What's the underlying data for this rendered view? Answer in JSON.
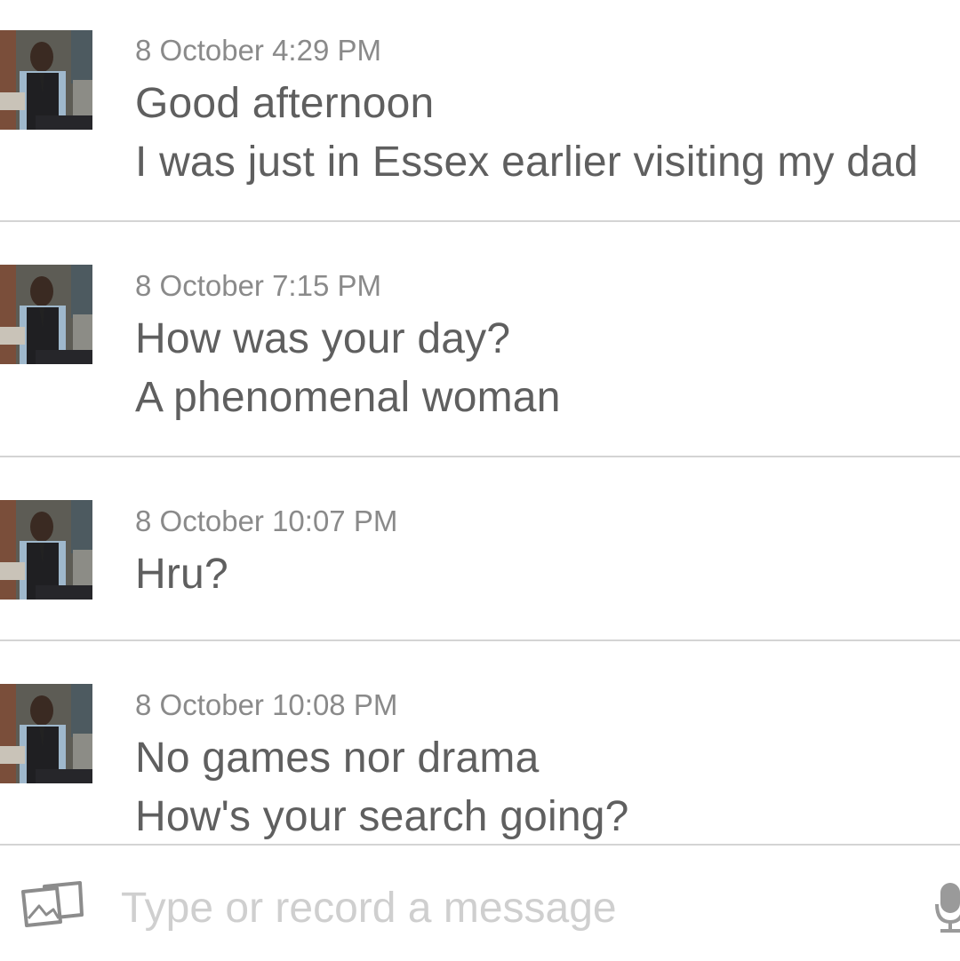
{
  "messages": [
    {
      "timestamp": "8 October 4:29 PM",
      "lines": [
        "Good afternoon",
        "I was just in Essex earlier visiting my dad"
      ]
    },
    {
      "timestamp": "8 October 7:15 PM",
      "lines": [
        "How was your day?",
        "A phenomenal woman"
      ]
    },
    {
      "timestamp": "8 October 10:07 PM",
      "lines": [
        "Hru?"
      ]
    },
    {
      "timestamp": "8 October 10:08 PM",
      "lines": [
        "No games nor drama",
        "How's your search going?"
      ]
    }
  ],
  "composer": {
    "placeholder": "Type or record a message",
    "value": "",
    "attach_icon": "photo-stack-icon",
    "mic_icon": "microphone-icon"
  },
  "colors": {
    "background": "#ffffff",
    "timestamp": "#8a8a8a",
    "message_text": "#5f5f5f",
    "placeholder": "#cfcfcf",
    "divider": "#d4d4d4"
  }
}
